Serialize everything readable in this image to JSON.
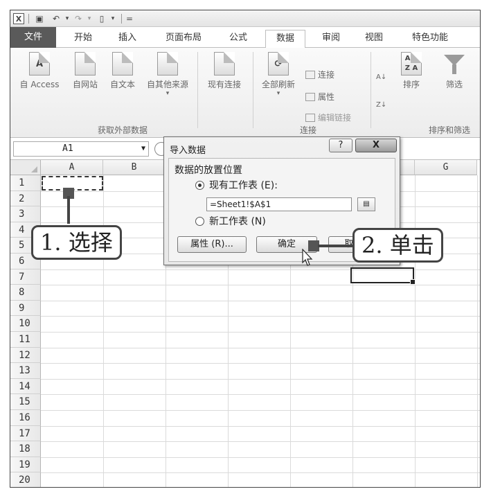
{
  "qat": {
    "app_icon": "excel-icon"
  },
  "tabs": [
    {
      "label": "文件",
      "active": false
    },
    {
      "label": "开始",
      "active": false
    },
    {
      "label": "插入",
      "active": false
    },
    {
      "label": "页面布局",
      "active": false
    },
    {
      "label": "公式",
      "active": false
    },
    {
      "label": "数据",
      "active": true
    },
    {
      "label": "审阅",
      "active": false
    },
    {
      "label": "视图",
      "active": false
    },
    {
      "label": "特色功能",
      "active": false
    }
  ],
  "ribbon": {
    "external": {
      "buttons": [
        {
          "label": "自 Access",
          "glyph": "A"
        },
        {
          "label": "自网站",
          "glyph": ""
        },
        {
          "label": "自文本",
          "glyph": ""
        },
        {
          "label": "自其他来源",
          "glyph": ""
        }
      ],
      "existing": "现有连接",
      "group_label": "获取外部数据"
    },
    "connections": {
      "refresh_all": "全部刷新",
      "items": [
        "连接",
        "属性",
        "编辑链接"
      ],
      "group_label": "连接"
    },
    "sort": {
      "sort_label": "排序",
      "filter_label": "筛选",
      "group_label": "排序和筛选",
      "az": "A Z\nZ A"
    }
  },
  "formula_bar": {
    "name_box": "A1"
  },
  "grid": {
    "columns": [
      "A",
      "B",
      "",
      "",
      "",
      "",
      "G"
    ],
    "rows": [
      "1",
      "2",
      "3",
      "4",
      "5",
      "6",
      "7",
      "8",
      "9",
      "10",
      "11",
      "12",
      "13",
      "14",
      "15",
      "16",
      "17",
      "18",
      "19",
      "20"
    ]
  },
  "dialog": {
    "title": "导入数据",
    "help": "?",
    "close": "X",
    "section_label": "数据的放置位置",
    "option_existing": "现有工作表 (E):",
    "address": "=Sheet1!$A$1",
    "option_new": "新工作表 (N)",
    "properties_button": "属性 (R)...",
    "ok_button": "确定",
    "cancel_button": "取"
  },
  "callouts": {
    "step1": "1. 选择",
    "step2": "2. 单击"
  }
}
